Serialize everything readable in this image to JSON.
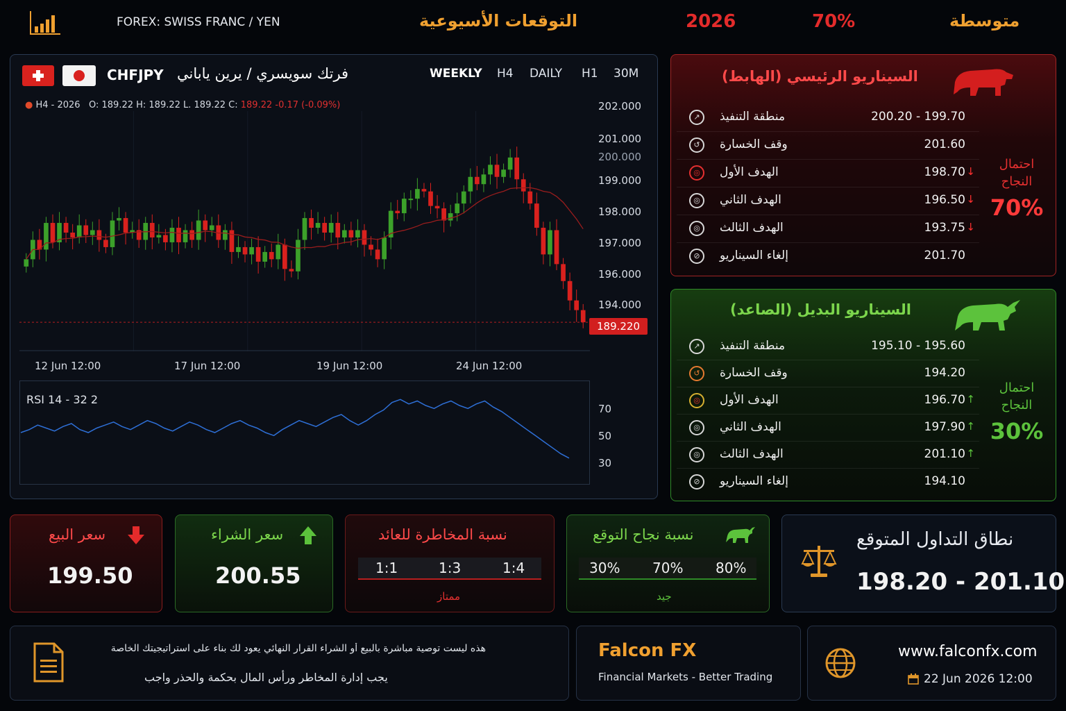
{
  "header": {
    "pair_label": "FOREX: SWISS FRANC / YEN",
    "section_title": "التوقعات الأسيوعية",
    "year": "2026",
    "percent": "70%",
    "level": "متوسطة"
  },
  "colors": {
    "accent_orange": "#f0a030",
    "bear_red": "#e32b2b",
    "bull_green": "#5cc23c",
    "candle_up": "#3ca12a",
    "candle_down": "#d9211e",
    "rsi_line": "#2e6fd6"
  },
  "chart": {
    "symbol": "CHFJPY",
    "symbol_ar": "فرتك سويسري / يرين ياباني",
    "timeframes": [
      "WEEKLY",
      "H4",
      "DAILY",
      "H1",
      "30M"
    ],
    "active_timeframe": "WEEKLY",
    "ohlc_prefix": "H4 - 2026",
    "ohlc_values": "O: 189.22  H: 189.22  L. 189.22  C:",
    "ohlc_close": "189.22",
    "ohlc_change": "-0.17 (-0.09%)",
    "current_price": "189.220",
    "price_ticks": [
      "202.000",
      "201.000",
      "200.000",
      "199.000",
      "198.000",
      "197.000",
      "196.000",
      "194.000"
    ],
    "time_ticks": [
      "12 Jun 12:00",
      "17 Jun 12:00",
      "19 Jun 12:00",
      "24 Jun 12:00"
    ],
    "rsi_label": "RSI 14 - 32 2",
    "rsi_ticks": [
      "70",
      "50",
      "30"
    ]
  },
  "chart_data": {
    "type": "candlestick",
    "series": [
      {
        "values": [
          196.4,
          197.2,
          196.8,
          197.9,
          197.1,
          197.9,
          197.5,
          197.3,
          197.8,
          197.4,
          197.6,
          197.2,
          196.9,
          198.0,
          198.1,
          197.5,
          197.6,
          197.2,
          197.9,
          197.3,
          197.4,
          197.1,
          197.7,
          197.1,
          197.6,
          197.2,
          198.0,
          197.6,
          197.8,
          197.2,
          197.6,
          196.7,
          196.9,
          196.6,
          196.9,
          196.3,
          196.7,
          196.4,
          197.0,
          196.0,
          195.9,
          197.2,
          198.1,
          197.7,
          197.9,
          197.5,
          197.9,
          197.3,
          197.6,
          197.3,
          197.6,
          197.0,
          196.8,
          196.4,
          197.3,
          198.4,
          198.3,
          198.9,
          198.9,
          199.3,
          199.2,
          198.6,
          198.5,
          198.0,
          198.3,
          198.7,
          199.2,
          199.8,
          199.5,
          199.9,
          200.3,
          199.8,
          200.1,
          200.6,
          199.7,
          199.2,
          198.7,
          197.7,
          196.6,
          197.6,
          196.2,
          195.5,
          194.7,
          194.3,
          193.8
        ]
      }
    ],
    "rsi": [
      50,
      52,
      55,
      53,
      51,
      54,
      56,
      52,
      50,
      53,
      55,
      57,
      54,
      52,
      55,
      58,
      56,
      53,
      51,
      54,
      57,
      55,
      52,
      50,
      53,
      56,
      58,
      55,
      53,
      50,
      48,
      52,
      55,
      58,
      56,
      54,
      57,
      60,
      62,
      58,
      55,
      58,
      62,
      65,
      70,
      72,
      69,
      71,
      68,
      66,
      69,
      71,
      68,
      66,
      69,
      71,
      67,
      64,
      60,
      56,
      52,
      48,
      44,
      40,
      36,
      33
    ],
    "ylim": [
      193,
      202
    ],
    "rsi_ylim": [
      20,
      80
    ]
  },
  "bear": {
    "title": "السيناريو الرئيسي (الهابط)",
    "prob_label": "احتمال النجاح",
    "prob_value": "70%",
    "rows": [
      {
        "label": "منطقة التنفيذ",
        "value": "200.20 - 199.70",
        "arrow": ""
      },
      {
        "label": "وقف الخسارة",
        "value": "201.60",
        "arrow": ""
      },
      {
        "label": "الهدف الأول",
        "value": "198.70",
        "arrow": "↓"
      },
      {
        "label": "الهدف الثاني",
        "value": "196.50",
        "arrow": "↓"
      },
      {
        "label": "الهدف الثالث",
        "value": "193.75",
        "arrow": "↓"
      },
      {
        "label": "إلغاء السيناريو",
        "value": "201.70",
        "arrow": ""
      }
    ]
  },
  "bull": {
    "title": "السيناريو البديل (الصاعد)",
    "prob_label": "احتمال النجاح",
    "prob_value": "30%",
    "rows": [
      {
        "label": "منطقة التنفيذ",
        "value": "195.10 - 195.60",
        "arrow": ""
      },
      {
        "label": "وقف الخسارة",
        "value": "194.20",
        "arrow": ""
      },
      {
        "label": "الهدف الأول",
        "value": "196.70",
        "arrow": "↑"
      },
      {
        "label": "الهدف الثاني",
        "value": "197.90",
        "arrow": "↑"
      },
      {
        "label": "الهدف الثالث",
        "value": "201.10",
        "arrow": "↑"
      },
      {
        "label": "إلغاء السيناريو",
        "value": "194.10",
        "arrow": ""
      }
    ]
  },
  "sell": {
    "title": "سعر البيع",
    "value": "199.50"
  },
  "buy": {
    "title": "سعر الشراء",
    "value": "200.55"
  },
  "risk": {
    "title": "نسبة المخاطرة للعائد",
    "ratios": [
      "1:1",
      "1:3",
      "1:4"
    ],
    "rating": "ممتاز"
  },
  "success": {
    "title": "نسبة نجاح التوقع",
    "ratios": [
      "30%",
      "70%",
      "80%"
    ],
    "rating": "جيد"
  },
  "range": {
    "title": "نطاق التداول المتوقع",
    "value": "198.20 - 201.10"
  },
  "footer": {
    "disclaimer_1": "هذه ليست توصية مباشرة بالبيع أو الشراء القرار النهائي يعود لك بناء على استراتيجيتك الخاصة",
    "disclaimer_2": "يجب إدارة المخاطر ورأس المال بحكمة والحذر واجب",
    "brand": "Falcon FX",
    "tagline": "Financial Markets - Better Trading",
    "website": "www.falconfx.com",
    "datetime": "22 Jun 2026 12:00"
  }
}
